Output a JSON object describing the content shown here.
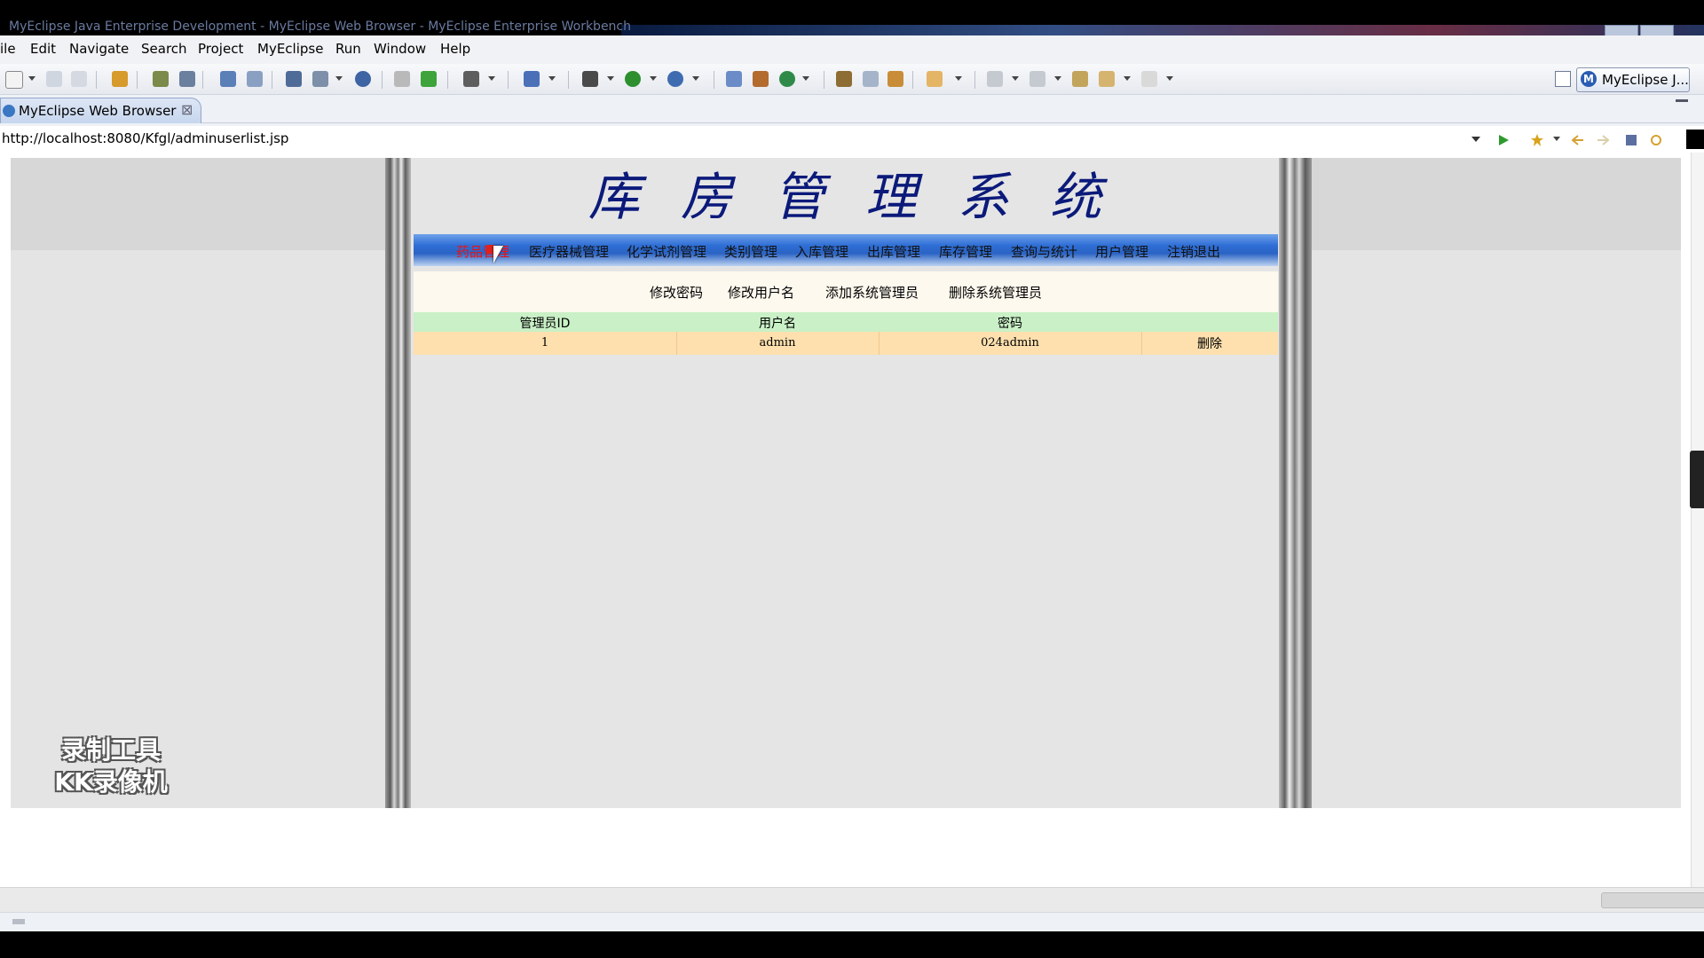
{
  "window": {
    "title": "MyEclipse Java Enterprise Development - MyEclipse Web Browser - MyEclipse Enterprise Workbench"
  },
  "menu": [
    "ile",
    "Edit",
    "Navigate",
    "Search",
    "Project",
    "MyEclipse",
    "Run",
    "Window",
    "Help"
  ],
  "perspective": {
    "label": "MyEclipse J..."
  },
  "editor_tab": {
    "label": "MyEclipse Web Browser",
    "close": "⊠"
  },
  "address": {
    "url": "http://localhost:8080/Kfgl/adminuserlist.jsp"
  },
  "page": {
    "title": "库房管理系统",
    "nav": [
      {
        "label": "药品管理"
      },
      {
        "label": "医疗器械管理"
      },
      {
        "label": "化学试剂管理"
      },
      {
        "label": "类别管理"
      },
      {
        "label": "入库管理"
      },
      {
        "label": "出库管理"
      },
      {
        "label": "库存管理"
      },
      {
        "label": "查询与统计"
      },
      {
        "label": "用户管理"
      },
      {
        "label": "注销退出"
      }
    ],
    "sub_nav": [
      {
        "label": "修改密码"
      },
      {
        "label": "修改用户名"
      },
      {
        "label": "添加系统管理员"
      },
      {
        "label": "删除系统管理员"
      }
    ],
    "table": {
      "headers": [
        "管理员ID",
        "用户名",
        "密码"
      ],
      "rows": [
        {
          "id": "1",
          "username": "admin",
          "password": "024admin",
          "action": "删除"
        }
      ]
    }
  },
  "watermark": {
    "line1": "录制工具",
    "line2": "KK录像机"
  },
  "colors": {
    "nav_gradient_top": "#6fa1ea",
    "nav_gradient_mid": "#2a63c4",
    "title_color": "#0b1a7a",
    "table_header": "#c9f0c6",
    "table_row": "#fde0ae",
    "active_nav": "#e11111"
  }
}
